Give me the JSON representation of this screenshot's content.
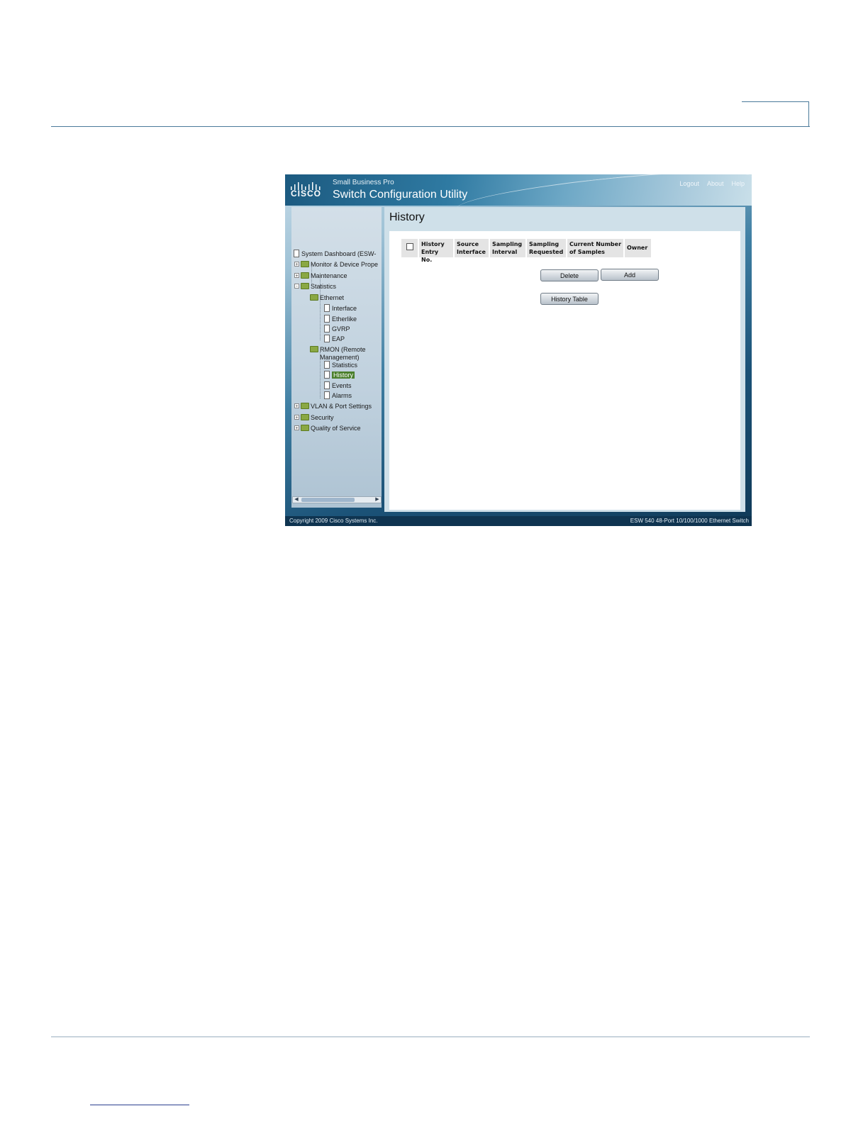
{
  "header": {
    "brand_subtitle": "Small Business Pro",
    "brand_title": "Switch Configuration Utility",
    "logo_text": "CISCO",
    "links": [
      "Logout",
      "About",
      "Help"
    ]
  },
  "nav": {
    "items": [
      {
        "label": "System Dashboard (ESW-",
        "icon": "document-icon"
      },
      {
        "label": "Monitor & Device Prope",
        "icon": "folder-icon",
        "expander": "+"
      },
      {
        "label": "Maintenance",
        "icon": "folder-icon",
        "expander": "+"
      },
      {
        "label": "Statistics",
        "icon": "folder-open-icon",
        "expander": "-"
      },
      {
        "label": "Ethernet",
        "icon": "folder-open-icon"
      },
      {
        "label": "Interface",
        "icon": "document-icon"
      },
      {
        "label": "Etherlike",
        "icon": "document-icon"
      },
      {
        "label": "GVRP",
        "icon": "document-icon"
      },
      {
        "label": "EAP",
        "icon": "document-icon"
      },
      {
        "label": "RMON (Remote",
        "icon": "folder-open-icon"
      },
      {
        "label": "Management)"
      },
      {
        "label": "Statistics",
        "icon": "document-icon"
      },
      {
        "label": "History",
        "icon": "document-icon",
        "selected": true
      },
      {
        "label": "Events",
        "icon": "document-icon"
      },
      {
        "label": "Alarms",
        "icon": "document-icon"
      },
      {
        "label": "VLAN & Port Settings",
        "icon": "folder-icon",
        "expander": "+"
      },
      {
        "label": "Security",
        "icon": "folder-icon",
        "expander": "+"
      },
      {
        "label": "Quality of Service",
        "icon": "folder-icon",
        "expander": "+"
      }
    ]
  },
  "main": {
    "title": "History",
    "table": {
      "columns": [
        {
          "line1": "History",
          "line2": "Entry No."
        },
        {
          "line1": "Source",
          "line2": "Interface"
        },
        {
          "line1": "Sampling",
          "line2": "Interval"
        },
        {
          "line1": "Sampling",
          "line2": "Requested"
        },
        {
          "line1": "Current Number",
          "line2": "of Samples"
        },
        {
          "line1": "Owner",
          "line2": ""
        }
      ],
      "rows": []
    },
    "buttons": {
      "delete": "Delete",
      "add": "Add",
      "history_table": "History Table"
    }
  },
  "footer": {
    "copyright": "Copyright 2009 Cisco Systems Inc.",
    "device": "ESW 540 48-Port 10/100/1000 Ethernet Switch"
  }
}
